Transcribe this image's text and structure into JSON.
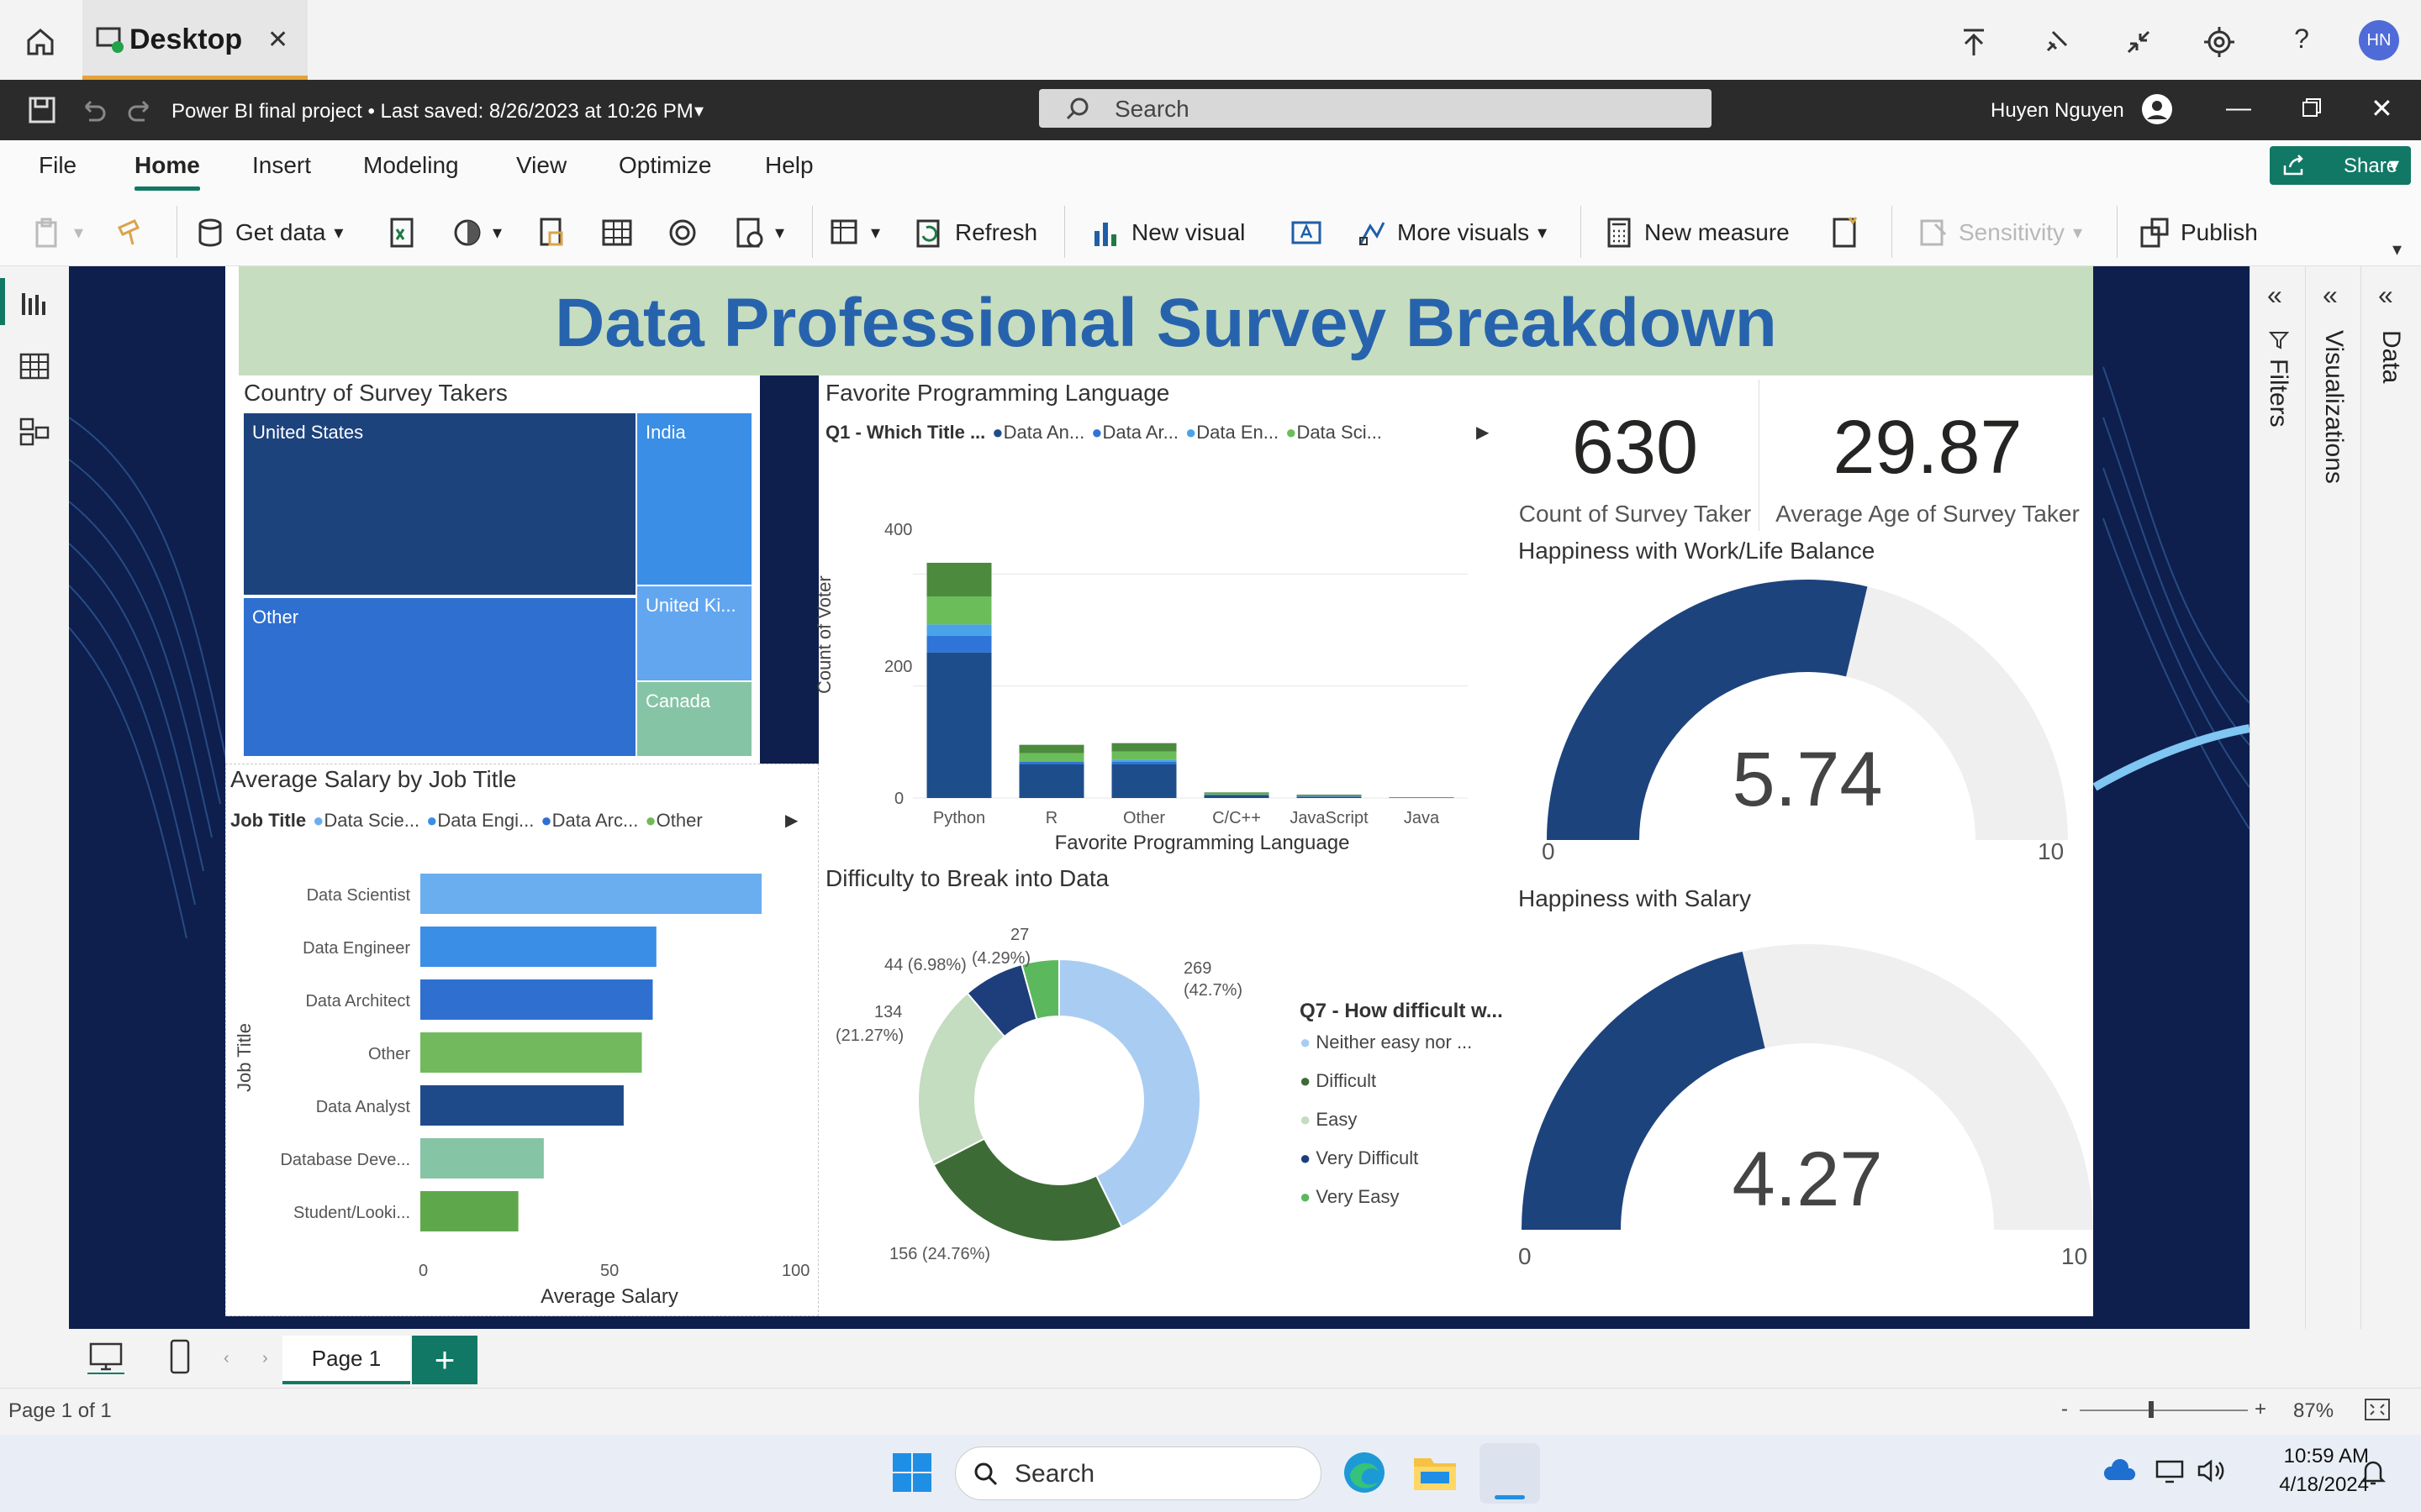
{
  "browser": {
    "tab_title": "Desktop",
    "avatar_initials": "HN"
  },
  "titlebar": {
    "file_title": "Power BI final project • Last saved: 8/26/2023 at 10:26 PM",
    "search_placeholder": "Search",
    "user_name": "Huyen Nguyen"
  },
  "ribbon_tabs": [
    "File",
    "Home",
    "Insert",
    "Modeling",
    "View",
    "Optimize",
    "Help"
  ],
  "share_label": "Share",
  "ribbon": {
    "get_data": "Get data",
    "refresh": "Refresh",
    "new_visual": "New visual",
    "more_visuals": "More visuals",
    "new_measure": "New measure",
    "sensitivity": "Sensitivity",
    "publish": "Publish"
  },
  "report": {
    "title": "Data Professional Survey Breakdown",
    "treemap": {
      "title": "Country of Survey Takers",
      "labels": [
        "United States",
        "India",
        "Other",
        "United Ki...",
        "Canada"
      ]
    },
    "lang_chart": {
      "title": "Favorite Programming Language",
      "legend_title": "Q1 - Which Title ...",
      "legend_items": [
        "Data An...",
        "Data Ar...",
        "Data En...",
        "Data Sci..."
      ],
      "ylabel": "Count of Voter",
      "xlabel": "Favorite Programming Language",
      "yticks": [
        "0",
        "200",
        "400"
      ]
    },
    "salary_chart": {
      "title": "Average Salary by Job Title",
      "legend_title": "Job Title",
      "legend_items": [
        "Data Scie...",
        "Data Engi...",
        "Data Arc...",
        "Other"
      ],
      "ylabel": "Job Title",
      "xlabel": "Average Salary",
      "xticks": [
        "0",
        "50",
        "100"
      ]
    },
    "donut": {
      "title": "Difficulty to Break into Data",
      "legend_title": "Q7 - How difficult w...",
      "legend_items": [
        "Neither easy nor ...",
        "Difficult",
        "Easy",
        "Very Difficult",
        "Very Easy"
      ],
      "labels": {
        "l269": "269",
        "l269p": "(42.7%)",
        "l156": "156 (24.76%)",
        "l134": "134",
        "l134p": "(21.27%)",
        "l44": "44 (6.98%)",
        "l27": "27",
        "l27p": "(4.29%)"
      }
    },
    "card_count": {
      "value": "630",
      "label": "Count of Survey Taker"
    },
    "card_age": {
      "value": "29.87",
      "label": "Average Age of Survey Taker"
    },
    "gauge_work": {
      "title": "Happiness with Work/Life Balance",
      "value": "5.74",
      "min": "0",
      "max": "10",
      "fraction": 0.574
    },
    "gauge_salary": {
      "title": "Happiness with Salary",
      "value": "4.27",
      "min": "0",
      "max": "10",
      "fraction": 0.427
    }
  },
  "chart_data": [
    {
      "type": "bar",
      "title": "Favorite Programming Language",
      "xlabel": "Favorite Programming Language",
      "ylabel": "Count of Voter",
      "categories": [
        "Python",
        "R",
        "Other",
        "C/C++",
        "JavaScript",
        "Java"
      ],
      "stacked": true,
      "ylim": [
        0,
        450
      ],
      "series": [
        {
          "name": "Data An...",
          "color": "#1e4d8c",
          "values": [
            260,
            60,
            60,
            5,
            2,
            1
          ]
        },
        {
          "name": "Data Ar...",
          "color": "#2f74d8",
          "values": [
            30,
            5,
            5,
            1,
            1,
            0
          ]
        },
        {
          "name": "Data En...",
          "color": "#4aa3e8",
          "values": [
            20,
            0,
            3,
            0,
            0,
            0
          ]
        },
        {
          "name": "Data Sci...",
          "color": "#6bbd59",
          "values": [
            50,
            15,
            15,
            2,
            1,
            0
          ]
        },
        {
          "name": "Other",
          "color": "#4c8a3e",
          "values": [
            60,
            15,
            15,
            2,
            2,
            0
          ]
        }
      ]
    },
    {
      "type": "bar",
      "orientation": "horizontal",
      "title": "Average Salary by Job Title",
      "xlabel": "Average Salary",
      "ylabel": "Job Title",
      "categories": [
        "Data Scientist",
        "Data Engineer",
        "Data Architect",
        "Other",
        "Data Analyst",
        "Database Deve...",
        "Student/Looki..."
      ],
      "values": [
        94,
        65,
        64,
        61,
        56,
        34,
        27
      ],
      "colors": [
        "#6aaef0",
        "#3a8ee6",
        "#2f6fd0",
        "#72b95d",
        "#1e4a8a",
        "#86c4a6",
        "#5ea84b"
      ],
      "xlim": [
        0,
        100
      ]
    },
    {
      "type": "pie",
      "title": "Difficulty to Break into Data",
      "categories": [
        "Neither easy nor ...",
        "Difficult",
        "Easy",
        "Very Difficult",
        "Very Easy"
      ],
      "values": [
        269,
        156,
        134,
        44,
        27
      ],
      "colors": [
        "#a9ccf2",
        "#3d6b35",
        "#c4dcbf",
        "#1d3e7a",
        "#5cb85c"
      ]
    }
  ],
  "page_tab": "Page 1",
  "status": {
    "page_count": "Page 1 of 1",
    "zoom": "87%"
  },
  "taskbar": {
    "search_placeholder": "Search",
    "time": "10:59 AM",
    "date": "4/18/2024"
  },
  "panes": {
    "filters": "Filters",
    "visualizations": "Visualizations",
    "data": "Data"
  }
}
